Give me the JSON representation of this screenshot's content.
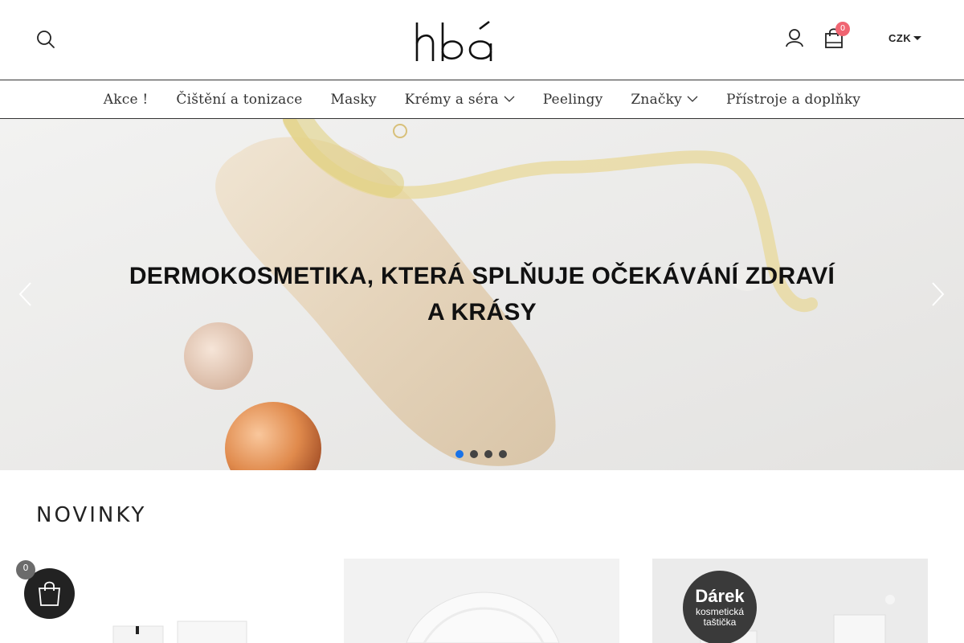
{
  "header": {
    "logo_text": "hbá",
    "cart_count": "0",
    "currency": "CZK"
  },
  "nav": {
    "items": [
      {
        "label": "Akce !",
        "has_dropdown": false
      },
      {
        "label": "Čištění a tonizace",
        "has_dropdown": false
      },
      {
        "label": "Masky",
        "has_dropdown": false
      },
      {
        "label": "Krémy a séra",
        "has_dropdown": true
      },
      {
        "label": "Peelingy",
        "has_dropdown": false
      },
      {
        "label": "Značky",
        "has_dropdown": true
      },
      {
        "label": "Přístroje a doplňky",
        "has_dropdown": false
      }
    ]
  },
  "hero": {
    "title": "DERMOKOSMETIKA, KTERÁ SPLŇUJE OČEKÁVÁNÍ ZDRAVÍ A KRÁSY",
    "slide_count": 4,
    "active_slide": 1,
    "active_dot_color": "#1a73e8"
  },
  "section": {
    "title": "NOVINKY"
  },
  "products": {
    "gift_badge_title": "Dárek",
    "gift_badge_sub_line1": "kosmetická",
    "gift_badge_sub_line2": "taštička"
  },
  "floating_cart": {
    "count": "0"
  },
  "icons": {
    "search": "search-icon",
    "account": "user-icon",
    "cart": "shopping-bag-icon",
    "prev": "chevron-left-icon",
    "next": "chevron-right-icon",
    "dropdown": "chevron-down-icon"
  },
  "colors": {
    "cart_badge": "#f06572",
    "floating_cart": "#222222"
  }
}
